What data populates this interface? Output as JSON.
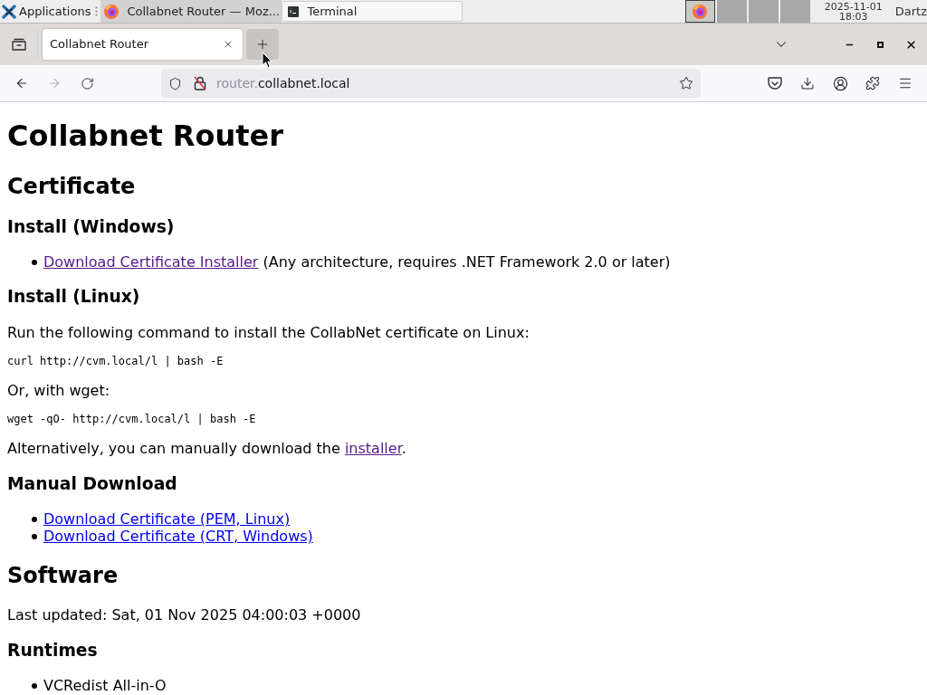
{
  "taskbar": {
    "menu_label": "Applications",
    "tasks": [
      {
        "title": "Collabnet Router — Moz...",
        "kind": "browser",
        "selected": true
      },
      {
        "title": "Terminal",
        "kind": "terminal",
        "selected": false
      }
    ],
    "workspaces": [
      {
        "selected": true,
        "kind": "occupied"
      },
      {
        "selected": false,
        "kind": "empty"
      },
      {
        "selected": false,
        "kind": "empty"
      },
      {
        "selected": false,
        "kind": "empty"
      }
    ],
    "clock": {
      "date": "2025-11-01",
      "time": "18:03"
    },
    "user": "Dartz"
  },
  "browser": {
    "tabs": [
      {
        "title": "Collabnet Router",
        "selected": true
      }
    ],
    "new_tab": {
      "hovered": true
    },
    "nav": {
      "back": {
        "disabled": false
      },
      "forward": {
        "disabled": true
      }
    },
    "address": {
      "subdomain": "router.",
      "domain": "collabnet.local"
    }
  },
  "page": {
    "blocks": [
      {
        "kind": "h1",
        "text": "Collabnet Router"
      },
      {
        "kind": "h2",
        "text": "Certificate"
      },
      {
        "kind": "h3",
        "text": "Install (Windows)"
      },
      {
        "kind": "list",
        "items": [
          {
            "parts": [
              {
                "kind": "link",
                "text": "Download Certificate Installer",
                "visited": true
              },
              {
                "kind": "text",
                "text": " (Any architecture, requires .NET Framework 2.0 or later)"
              }
            ]
          }
        ]
      },
      {
        "kind": "h3",
        "text": "Install (Linux)"
      },
      {
        "kind": "p",
        "parts": [
          {
            "kind": "text",
            "text": "Run the following command to install the CollabNet certificate on Linux:"
          }
        ]
      },
      {
        "kind": "code",
        "text": "curl http://cvm.local/l | bash -E"
      },
      {
        "kind": "p",
        "parts": [
          {
            "kind": "text",
            "text": "Or, with wget:"
          }
        ]
      },
      {
        "kind": "code",
        "text": "wget -qO- http://cvm.local/l | bash -E"
      },
      {
        "kind": "p",
        "parts": [
          {
            "kind": "text",
            "text": "Alternatively, you can manually download the "
          },
          {
            "kind": "link",
            "text": "installer",
            "visited": true
          },
          {
            "kind": "text",
            "text": "."
          }
        ]
      },
      {
        "kind": "h3",
        "text": "Manual Download"
      },
      {
        "kind": "list",
        "items": [
          {
            "parts": [
              {
                "kind": "link",
                "text": "Download Certificate (PEM, Linux)",
                "visited": false
              }
            ]
          },
          {
            "parts": [
              {
                "kind": "link",
                "text": "Download Certificate (CRT, Windows)",
                "visited": false
              }
            ]
          }
        ]
      },
      {
        "kind": "h2",
        "text": "Software"
      },
      {
        "kind": "p",
        "parts": [
          {
            "kind": "text",
            "text": "Last updated: Sat, 01 Nov 2025 04:00:03 +0000"
          }
        ]
      },
      {
        "kind": "h3",
        "text": "Runtimes"
      },
      {
        "kind": "list",
        "items": [
          {
            "parts": [
              {
                "kind": "text",
                "text": "VCRedist All-in-O"
              }
            ]
          }
        ]
      }
    ]
  }
}
